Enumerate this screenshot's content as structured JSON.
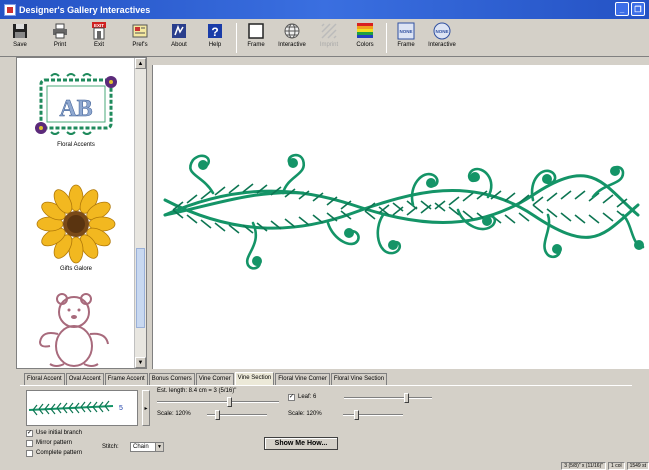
{
  "window": {
    "title": "Designer's Gallery Interactives",
    "minimize_label": "_",
    "restore_label": "❐"
  },
  "toolbar": {
    "items": [
      {
        "label": "Save",
        "icon": "floppy-disk-icon"
      },
      {
        "label": "Print",
        "icon": "printer-icon"
      },
      {
        "label": "Exit",
        "icon": "exit-icon",
        "badge": "EXIT"
      },
      {
        "label": "Pref's",
        "icon": "preferences-icon"
      },
      {
        "label": "About",
        "icon": "about-icon"
      },
      {
        "label": "Help",
        "icon": "help-icon",
        "glyph": "?"
      },
      {
        "label": "Frame",
        "icon": "frame-icon"
      },
      {
        "label": "Interactive",
        "icon": "globe-icon"
      },
      {
        "label": "Imprint",
        "icon": "imprint-icon",
        "disabled": true
      },
      {
        "label": "Colors",
        "icon": "colors-icon"
      },
      {
        "label": "Frame",
        "icon": "frame-none-icon",
        "badge": "NONE"
      },
      {
        "label": "Interactive",
        "icon": "interactive-none-icon",
        "badge": "NONE"
      }
    ]
  },
  "sidebar": {
    "items": [
      {
        "label": "Floral Accents",
        "monogram": "AB"
      },
      {
        "label": "Gifts Galore"
      },
      {
        "label": ""
      }
    ],
    "scroll_up": "▲",
    "scroll_down": "▼"
  },
  "tabs": [
    {
      "label": "Floral Accent",
      "active": false
    },
    {
      "label": "Oval Accent",
      "active": false
    },
    {
      "label": "Frame Accent",
      "active": false
    },
    {
      "label": "Bonus Corners",
      "active": false
    },
    {
      "label": "Vine Corner",
      "active": false
    },
    {
      "label": "Vine Section",
      "active": true
    },
    {
      "label": "Floral Vine Corner",
      "active": false
    },
    {
      "label": "Floral Vine Section",
      "active": false
    }
  ],
  "panel": {
    "preview_number": "5",
    "preview_dropdown": "▸",
    "est_length": "Est. length: 8.4 cm = 3 (5/16)\"",
    "leaf_label": "Leaf: 6",
    "leaf_checked": true,
    "scale_left": "Scale: 120%",
    "scale_right": "Scale: 120%",
    "use_initial_branch": "Use initial branch",
    "use_initial_branch_checked": true,
    "mirror_pattern": "Mirror pattern",
    "mirror_pattern_checked": false,
    "complete_pattern": "Complete pattern",
    "complete_pattern_checked": false,
    "stitch_label": "Stitch:",
    "stitch_value": "Chain",
    "show_me_how": "Show Me How...",
    "slider_est_length": 0.6,
    "slider_leaf": 0.72,
    "slider_scale_left": 0.15,
    "slider_scale_right": 0.2
  },
  "status": {
    "size": "3 (5/8)\" x (11/16)\"",
    "cols": "1 col",
    "stitches": "1549 st"
  },
  "colors": {
    "title_bar": "#2452c4",
    "vine_green": "#149467",
    "vine_dark": "#0d7552",
    "sunflower_yellow": "#f2b820",
    "sunflower_center": "#7a4a18",
    "frame_green": "#1f8a5c",
    "frame_purple": "#5b2a7a",
    "monogram_blue": "#8fa8d0",
    "bear_outline": "#a86a7c"
  }
}
